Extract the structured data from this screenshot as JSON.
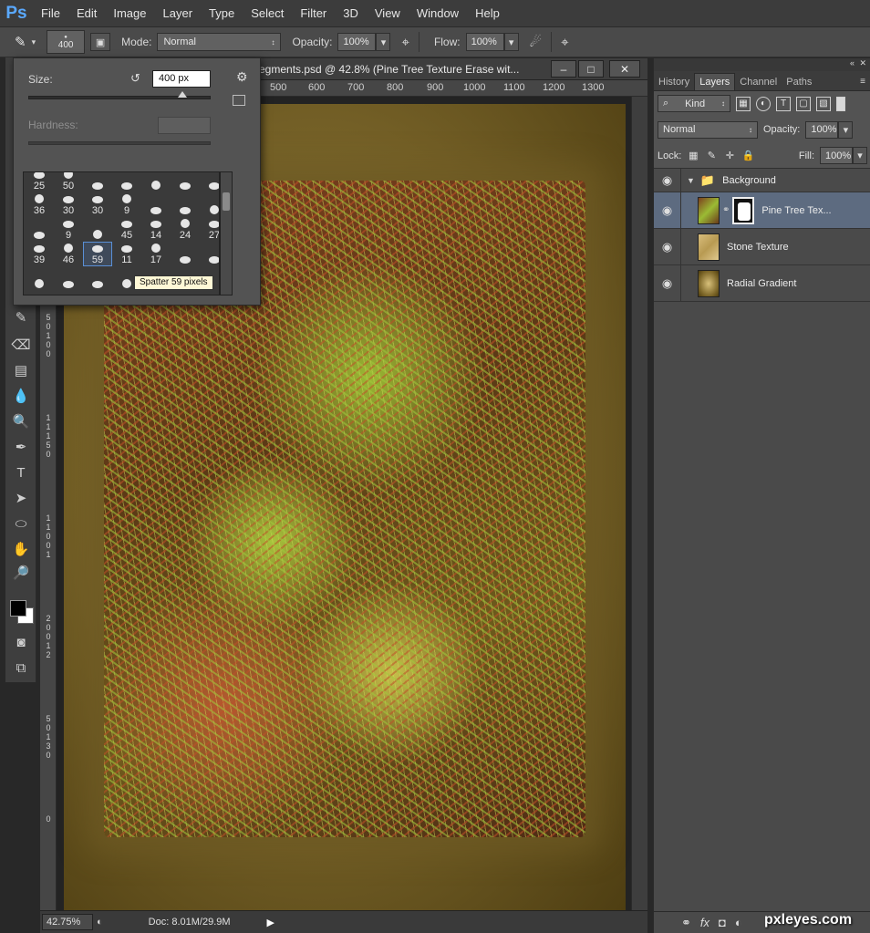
{
  "app": {
    "logo": "Ps"
  },
  "menu": [
    "File",
    "Edit",
    "Image",
    "Layer",
    "Type",
    "Select",
    "Filter",
    "3D",
    "View",
    "Window",
    "Help"
  ],
  "options_bar": {
    "brush_size": "400",
    "mode_label": "Mode:",
    "mode_value": "Normal",
    "opacity_label": "Opacity:",
    "opacity_value": "100%",
    "flow_label": "Flow:",
    "flow_value": "100%"
  },
  "document": {
    "title": "egments.psd @ 42.8% (Pine Tree Texture   Erase wit...",
    "ruler_ticks": [
      "500",
      "600",
      "700",
      "800",
      "900",
      "1000",
      "1100",
      "1200",
      "1300"
    ],
    "left_ruler": [
      "5",
      "0",
      "1",
      "0",
      "0",
      "1",
      "1",
      "1",
      "5",
      "0",
      "1",
      "1",
      "0",
      "0",
      "1",
      "2",
      "0",
      "0",
      "1",
      "2",
      "5",
      "0",
      "1",
      "3",
      "0",
      "0"
    ],
    "zoom": "42.75%",
    "doc_info": "Doc: 8.01M/29.9M"
  },
  "brush_popup": {
    "size_label": "Size:",
    "size_value": "400 px",
    "hardness_label": "Hardness:",
    "size_fraction": 0.84,
    "presets": [
      "25",
      "50",
      "",
      "",
      "",
      "",
      "",
      "36",
      "30",
      "30",
      "9",
      "",
      "",
      "",
      "",
      "9",
      "",
      "45",
      "14",
      "24",
      "27",
      "39",
      "46",
      "59",
      "11",
      "17",
      "",
      "",
      "",
      "",
      "",
      ""
    ],
    "selected_index": 23,
    "tooltip": "Spatter 59 pixels"
  },
  "layers_panel": {
    "tabs": [
      "History",
      "Layers",
      "Channel",
      "Paths"
    ],
    "active_tab": "Layers",
    "filter_kind": "Kind",
    "blend_mode": "Normal",
    "opacity_label": "Opacity:",
    "opacity_value": "100%",
    "lock_label": "Lock:",
    "fill_label": "Fill:",
    "fill_value": "100%",
    "layers": [
      {
        "name": "Background",
        "type": "group"
      },
      {
        "name": "Pine Tree Tex...",
        "type": "layer",
        "selected": true
      },
      {
        "name": "Stone Texture",
        "type": "layer"
      },
      {
        "name": "Radial Gradient",
        "type": "layer"
      }
    ]
  },
  "watermark": "pxleyes.com",
  "colors": {
    "accent": "#5aa9ff",
    "selected_layer": "#5d6b80",
    "foreground": "#000000",
    "background": "#ffffff"
  }
}
